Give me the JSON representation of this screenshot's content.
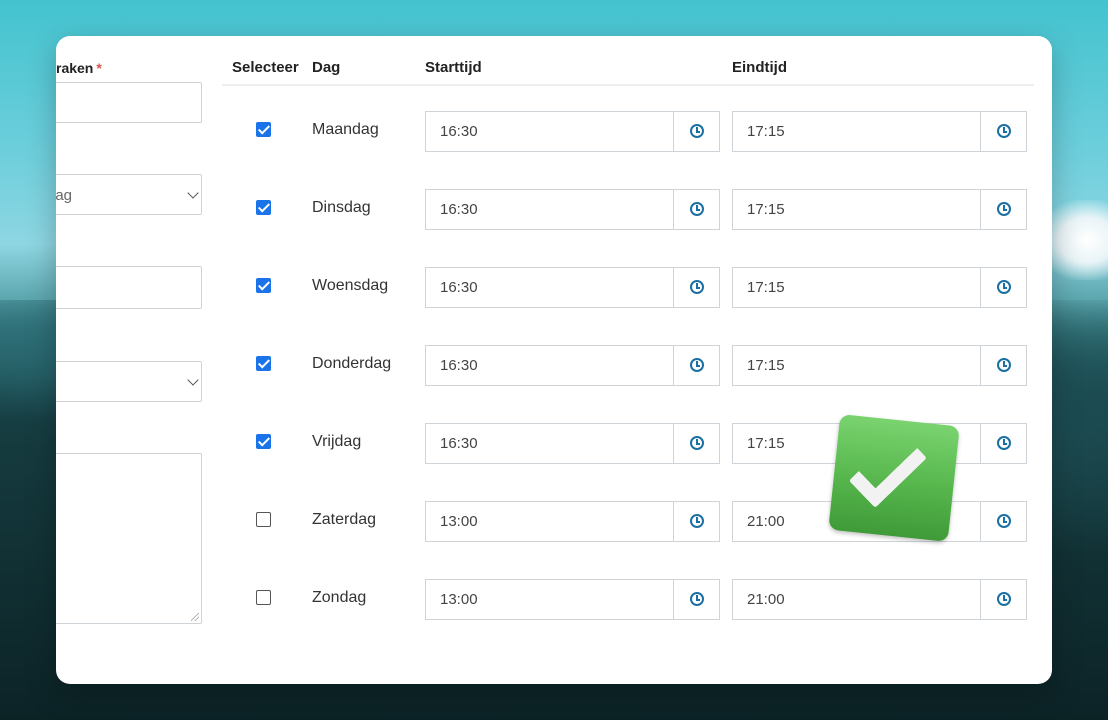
{
  "left_form": {
    "label_fragment": "raken",
    "required_mark": "*",
    "select_fragment": "dag"
  },
  "table": {
    "headers": {
      "select": "Selecteer",
      "day": "Dag",
      "start": "Starttijd",
      "end": "Eindtijd"
    },
    "rows": [
      {
        "day": "Maandag",
        "checked": true,
        "start": "16:30",
        "end": "17:15"
      },
      {
        "day": "Dinsdag",
        "checked": true,
        "start": "16:30",
        "end": "17:15"
      },
      {
        "day": "Woensdag",
        "checked": true,
        "start": "16:30",
        "end": "17:15"
      },
      {
        "day": "Donderdag",
        "checked": true,
        "start": "16:30",
        "end": "17:15"
      },
      {
        "day": "Vrijdag",
        "checked": true,
        "start": "16:30",
        "end": "17:15"
      },
      {
        "day": "Zaterdag",
        "checked": false,
        "start": "13:00",
        "end": "21:00"
      },
      {
        "day": "Zondag",
        "checked": false,
        "start": "13:00",
        "end": "21:00"
      }
    ]
  },
  "icons": {
    "time_picker": "clock-icon",
    "overlay": "check-mark-emoji"
  },
  "colors": {
    "checkbox_checked": "#1a73e8",
    "clock_icon": "#1a6fa3",
    "required": "#d9534f",
    "overlay_check": "#56b64c"
  }
}
